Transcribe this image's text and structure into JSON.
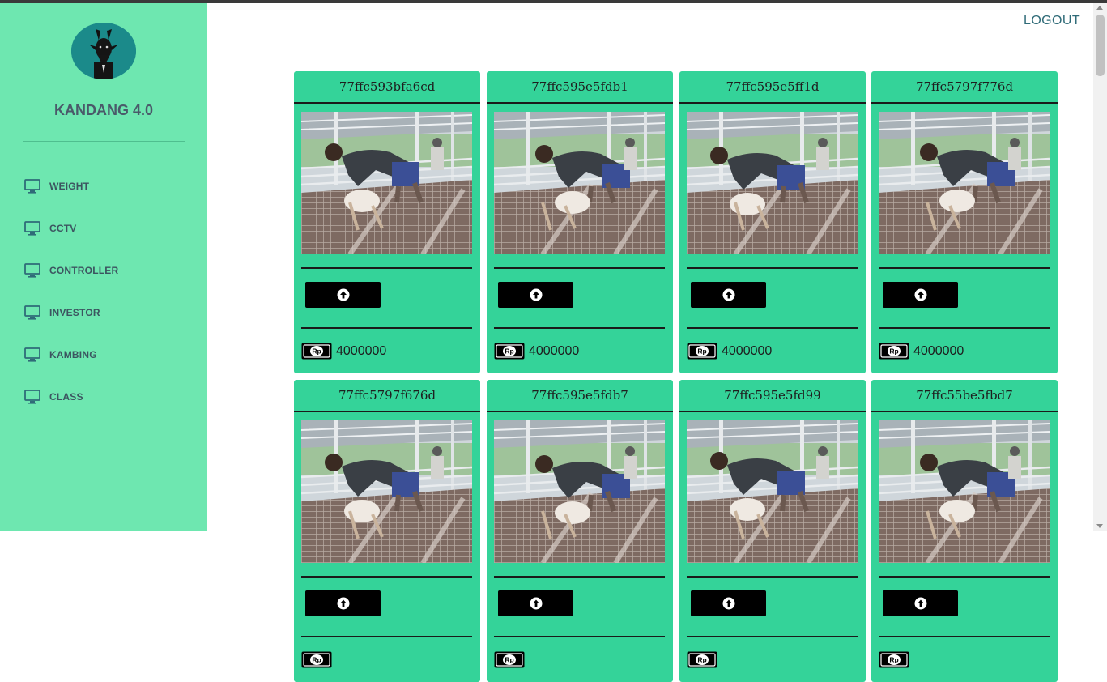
{
  "sidebar": {
    "brand": "KANDANG 4.0",
    "items": [
      {
        "label": "WEIGHT",
        "icon": "monitor-icon"
      },
      {
        "label": "CCTV",
        "icon": "monitor-icon"
      },
      {
        "label": "CONTROLLER",
        "icon": "monitor-icon"
      },
      {
        "label": "INVESTOR",
        "icon": "monitor-icon"
      },
      {
        "label": "KAMBING",
        "icon": "monitor-icon"
      },
      {
        "label": "CLASS",
        "icon": "monitor-icon"
      }
    ]
  },
  "header": {
    "logout": "LOGOUT"
  },
  "colors": {
    "sidebar": "#6ee7b0",
    "card": "#34d399",
    "button": "#000000"
  },
  "cards": [
    {
      "id": "77ffc593bfa6cd",
      "price": "4000000",
      "currency_badge": "Rp"
    },
    {
      "id": "77ffc595e5fdb1",
      "price": "4000000",
      "currency_badge": "Rp"
    },
    {
      "id": "77ffc595e5ff1d",
      "price": "4000000",
      "currency_badge": "Rp"
    },
    {
      "id": "77ffc5797f776d",
      "price": "4000000",
      "currency_badge": "Rp"
    },
    {
      "id": "77ffc5797f676d",
      "price": "",
      "currency_badge": "Rp"
    },
    {
      "id": "77ffc595e5fdb7",
      "price": "",
      "currency_badge": "Rp"
    },
    {
      "id": "77ffc595e5fd99",
      "price": "",
      "currency_badge": "Rp"
    },
    {
      "id": "77ffc55be5fbd7",
      "price": "",
      "currency_badge": "Rp"
    }
  ]
}
